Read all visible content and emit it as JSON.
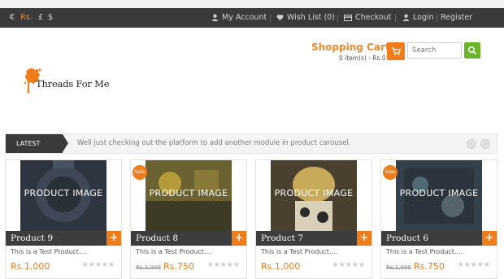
{
  "topbar": {
    "currencies": [
      "€",
      "Rs.",
      "£",
      "$"
    ],
    "active_currency": "Rs.",
    "my_account": "My Account",
    "wish_list": "Wish List (0)",
    "checkout": "Checkout",
    "login": "Login",
    "register": "Register"
  },
  "logo": {
    "text": "Threads For Me"
  },
  "cart": {
    "title": "Shopping Cart",
    "summary": "0 item(s) - Rs.0"
  },
  "search": {
    "placeholder": "Search"
  },
  "latest": {
    "tag": "LATEST",
    "message": "Well just checking out the platform to add another module in product carousel."
  },
  "products": [
    {
      "name": "Product 9",
      "image_label": "PRODUCT IMAGE",
      "desc": "This is a Test Product....",
      "price": "Rs.1,000",
      "old_price": "",
      "sale": false
    },
    {
      "name": "Product 8",
      "image_label": "PRODUCT IMAGE",
      "desc": "This is a Test Product....",
      "price": "Rs.750",
      "old_price": "Rs.1,000",
      "sale": true
    },
    {
      "name": "Product 7",
      "image_label": "PRODUCT IMAGE",
      "desc": "This is a Test Product....",
      "price": "Rs.1,000",
      "old_price": "",
      "sale": false
    },
    {
      "name": "Product 6",
      "image_label": "PRODUCT IMAGE",
      "desc": "This is a Test Product....",
      "price": "Rs.750",
      "old_price": "Rs.1,000",
      "sale": true
    }
  ],
  "sale_badge": "Sale",
  "rating_stars": "★★★★★",
  "colors": {
    "accent": "#ef7d1c",
    "topbar": "#3a3a3a",
    "search_btn": "#6cb42a"
  }
}
